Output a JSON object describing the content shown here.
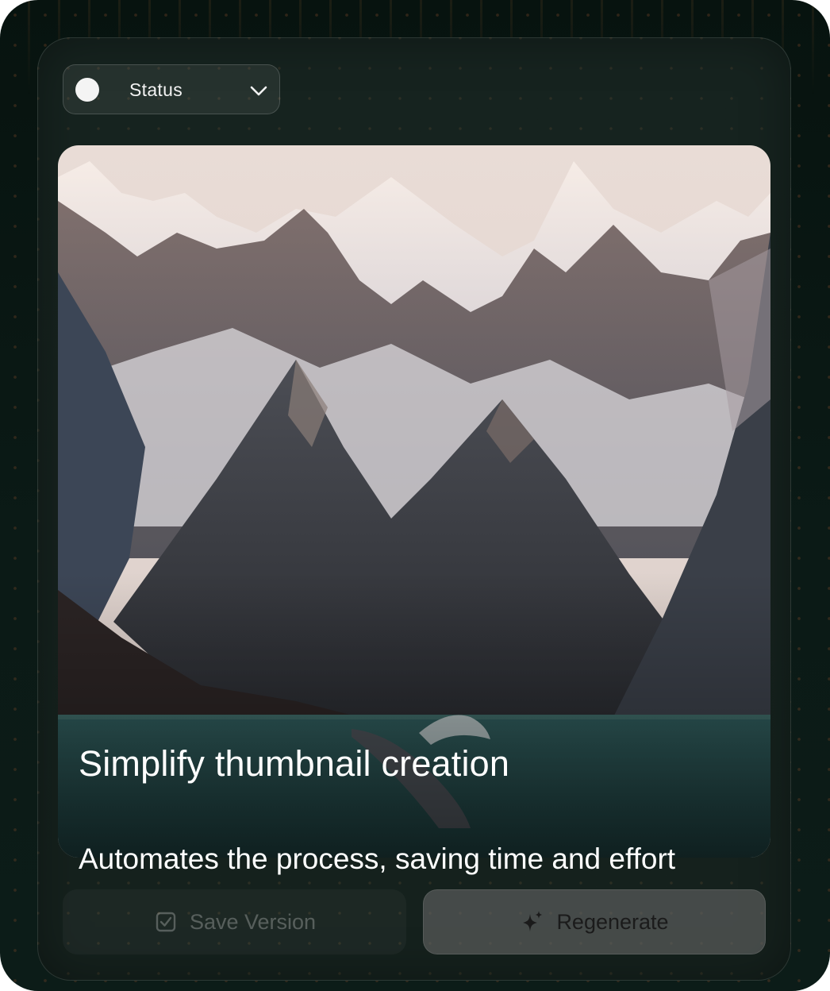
{
  "status_dropdown": {
    "label": "Status",
    "indicator_icon": "status-dot-icon",
    "toggle_icon": "chevron-down-icon"
  },
  "hero": {
    "image_description_icon": "mountain-fjord-whale-photo",
    "title": "Simplify thumbnail creation",
    "subtitle": "Automates the process, saving time and effort"
  },
  "actions": {
    "save_label": "Save Version",
    "save_icon": "checkbox-icon",
    "regenerate_label": "Regenerate",
    "regenerate_icon": "sparkle-icon"
  },
  "colors": {
    "background": "#0b1a16",
    "card": "#16231f",
    "text": "#ffffff",
    "regenerate_text": "#1b1b1b"
  }
}
